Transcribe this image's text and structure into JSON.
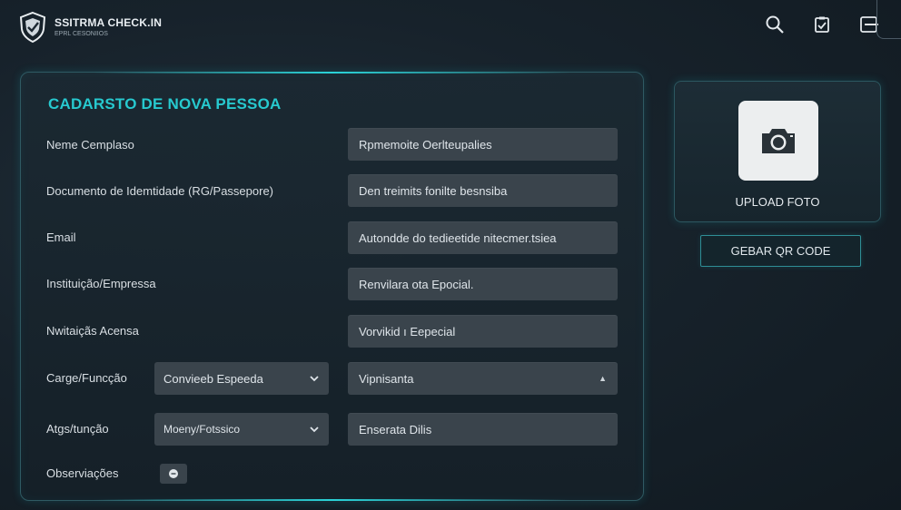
{
  "header": {
    "app_title": "SSITRMA CHECK.IN",
    "app_subtitle": "EPRL CESONIIOS",
    "icons": [
      "search-icon",
      "clipboard-check-icon",
      "logout-icon"
    ]
  },
  "form": {
    "title": "CADARSTO DE NOVA PESSOA",
    "fields": [
      {
        "label": "Neme Cemplaso",
        "value": "Rpmemoite Oerlteupalies"
      },
      {
        "label": "Documento de Idemtidade (RG/Passepore)",
        "value": "Den treimits fonilte besnsiba"
      },
      {
        "label": "Email",
        "value": "Autondde do tedieetide nitecmer.tsiea"
      },
      {
        "label": "Instituição/Empressa",
        "value": "Renvilara ota Epocial."
      },
      {
        "label": "Nwitaiçãs Acensa",
        "value": "Vorvikid ı Eepecial"
      }
    ],
    "cargo": {
      "label": "Carge/Funcção",
      "select": "Convieeb Espeeda",
      "value": "Vipnisanta"
    },
    "atgs": {
      "label": "Atgs/tunção",
      "select": "Moeny/Fotssico",
      "value": "Enserata Dilis"
    },
    "obs_label": "Observiações"
  },
  "upload": {
    "label": "UPLOAD FOTO"
  },
  "qr_button": {
    "label": "GEBAR QR CODE"
  },
  "colors": {
    "accent": "#27c9cf",
    "background": "#17222b",
    "field": "#3a444c"
  }
}
